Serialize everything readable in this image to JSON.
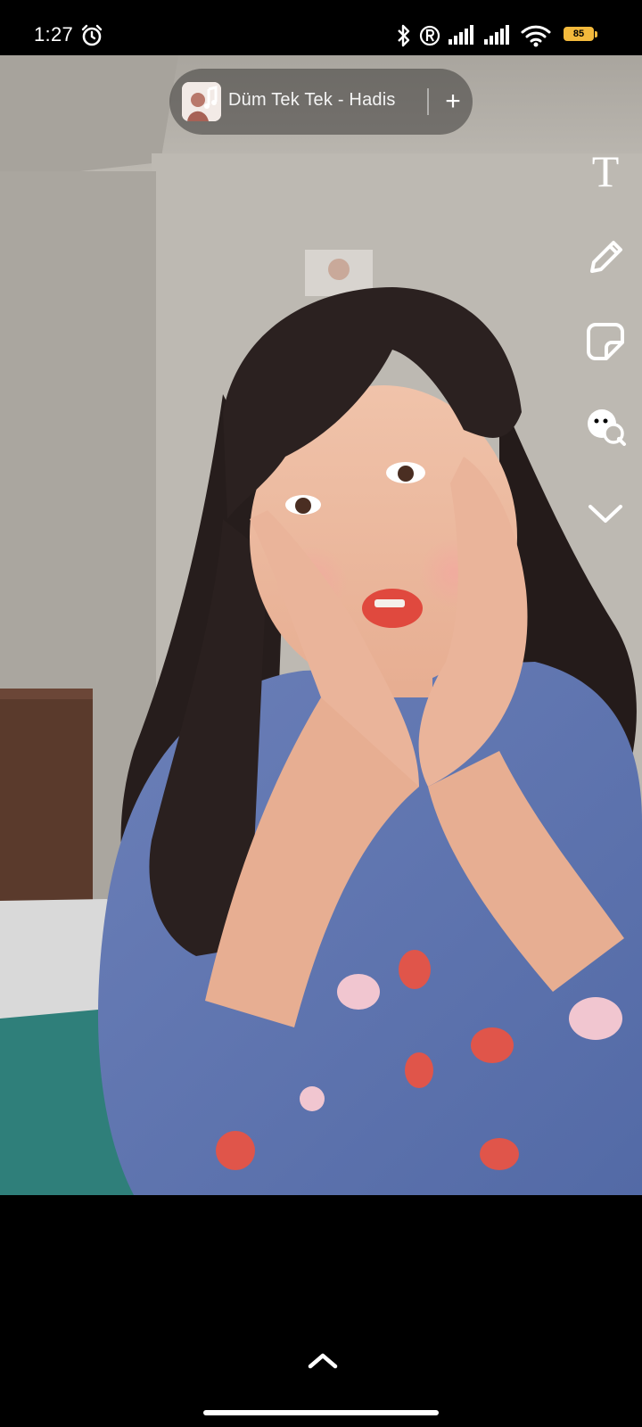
{
  "status_bar": {
    "time": "1:27",
    "battery": "85",
    "icons": [
      "alarm-icon",
      "bluetooth-icon",
      "registered-icon",
      "signal-icon",
      "signal-icon",
      "wifi-icon",
      "battery-icon"
    ]
  },
  "music": {
    "title": "Düm Tek Tek - Hadis",
    "add_label": "+"
  },
  "tools": {
    "text_label": "T",
    "icons": [
      "text-icon",
      "pencil-icon",
      "sticker-icon",
      "lens-emoji-icon",
      "chevron-down-icon"
    ]
  },
  "bottom": {
    "icons": [
      "chevron-up-icon"
    ]
  },
  "colors": {
    "battery": "#f3b93c",
    "chip_bg": "rgba(60,58,56,0.55)",
    "wall": "#bbb7b0"
  }
}
